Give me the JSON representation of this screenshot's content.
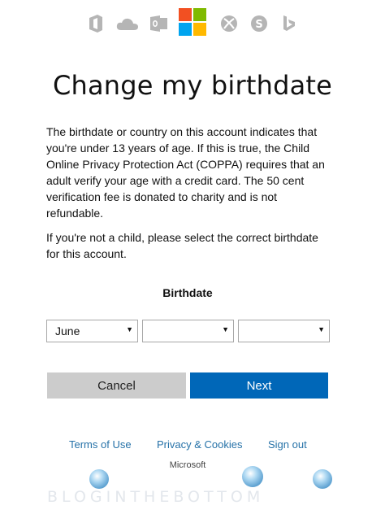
{
  "icons": [
    "office-icon",
    "onedrive-icon",
    "outlook-icon",
    "microsoft-logo",
    "xbox-icon",
    "skype-icon",
    "bing-icon"
  ],
  "colors": {
    "accent": "#0067b8",
    "cancel_bg": "#cccccc",
    "link": "#2672a8",
    "icon_gray": "#b5b5b5",
    "ms_red": "#f25022",
    "ms_green": "#7fba00",
    "ms_blue": "#00a4ef",
    "ms_yellow": "#ffb900"
  },
  "page": {
    "title": "Change my birthdate",
    "paragraph1": "The birthdate or country on this account indicates that you're under 13 years of age. If this is true, the Child Online Privacy Protection Act (COPPA) requires that an adult verify your age with a credit card. The 50 cent verification fee is donated to charity and is not refundable.",
    "paragraph2": "If you're not a child, please select the correct birthdate for this account."
  },
  "birthdate": {
    "label": "Birthdate",
    "month": "June",
    "day": "",
    "year": ""
  },
  "buttons": {
    "cancel": "Cancel",
    "next": "Next"
  },
  "footer": {
    "terms": "Terms of Use",
    "privacy": "Privacy & Cookies",
    "signout": "Sign out",
    "brand": "Microsoft"
  },
  "watermark": {
    "text": "BLOGINTHEBOTTOM"
  }
}
